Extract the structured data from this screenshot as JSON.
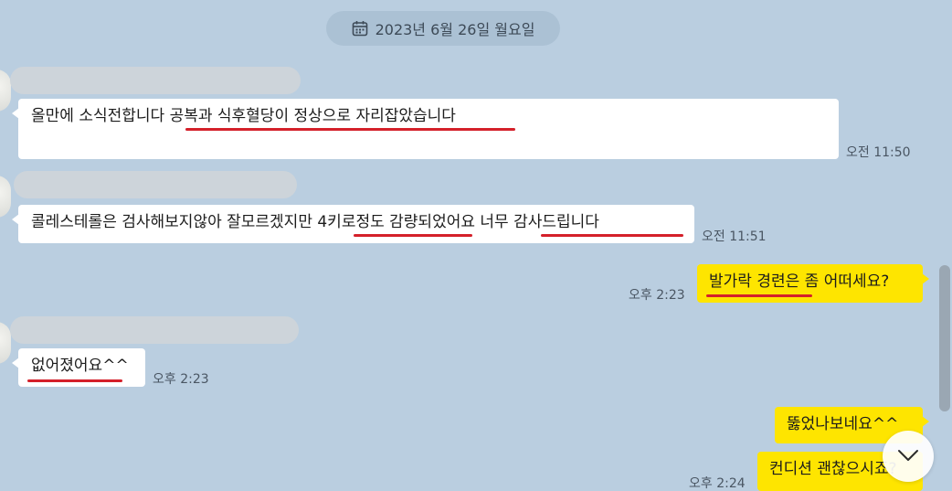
{
  "date_divider": {
    "text": "2023년 6월 26일 월요일",
    "icon": "calendar-icon"
  },
  "messages": [
    {
      "sender": "incoming",
      "text": "올만에 소식전합니다 공복과 식후혈당이 정상으로 자리잡았습니다",
      "time": "오전 11:50"
    },
    {
      "sender": "incoming",
      "text": "콜레스테롤은 검사해보지않아 잘모르겠지만 4키로정도 감량되었어요 너무 감사드립니다",
      "time": "오전 11:51"
    },
    {
      "sender": "outgoing",
      "text": "발가락 경련은 좀 어떠세요?",
      "time": "오후 2:23"
    },
    {
      "sender": "incoming",
      "text": "없어졌어요^^",
      "time": "오후 2:23"
    },
    {
      "sender": "outgoing",
      "text": "뚫었나보네요^^",
      "time": ""
    },
    {
      "sender": "outgoing",
      "text": "컨디션 괜찮으시죠?",
      "time": "오후 2:24"
    }
  ],
  "colors": {
    "background": "#bacee0",
    "outgoing_bubble": "#fee500",
    "incoming_bubble": "#ffffff",
    "annotation_underline": "#d4202a"
  },
  "scroll_button": {
    "icon": "chevron-down-icon"
  }
}
